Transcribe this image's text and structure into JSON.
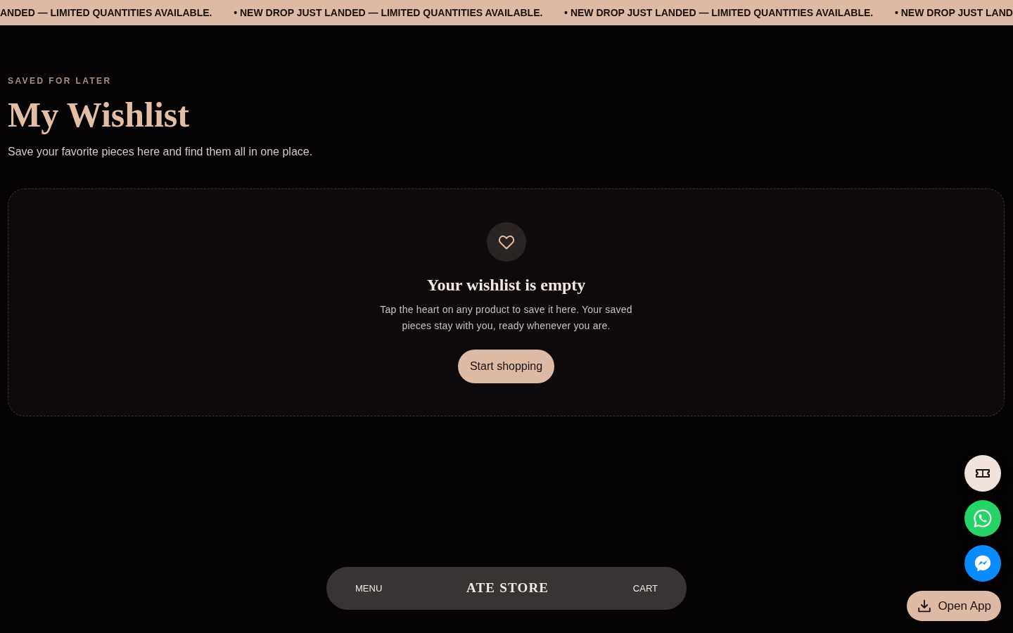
{
  "announcement_bar": {
    "items": [
      "ANDED — LIMITED QUANTITIES AVAILABLE.",
      "• NEW DROP JUST LANDED — LIMITED QUANTITIES AVAILABLE.",
      "• NEW DROP JUST LANDED — LIMITED QUANTITIES AVAILABLE.",
      "• NEW DROP JUST LAND"
    ]
  },
  "header": {
    "eyebrow": "SAVED FOR LATER",
    "title": "My Wishlist",
    "subtitle": "Save your favorite pieces here and find them all in one place."
  },
  "empty_state": {
    "title": "Your wishlist is empty",
    "message": "Tap the heart on any product to save it here. Your saved pieces stay with you, ready whenever you are.",
    "button": "Start shopping"
  },
  "bottom_nav": {
    "menu": "MENU",
    "logo": "ATE STORE",
    "cart": "CART"
  },
  "floating_actions": [
    {
      "kind": "ticket"
    },
    {
      "kind": "whatsapp"
    },
    {
      "kind": "messenger"
    }
  ],
  "open_app_button": "Open App"
}
